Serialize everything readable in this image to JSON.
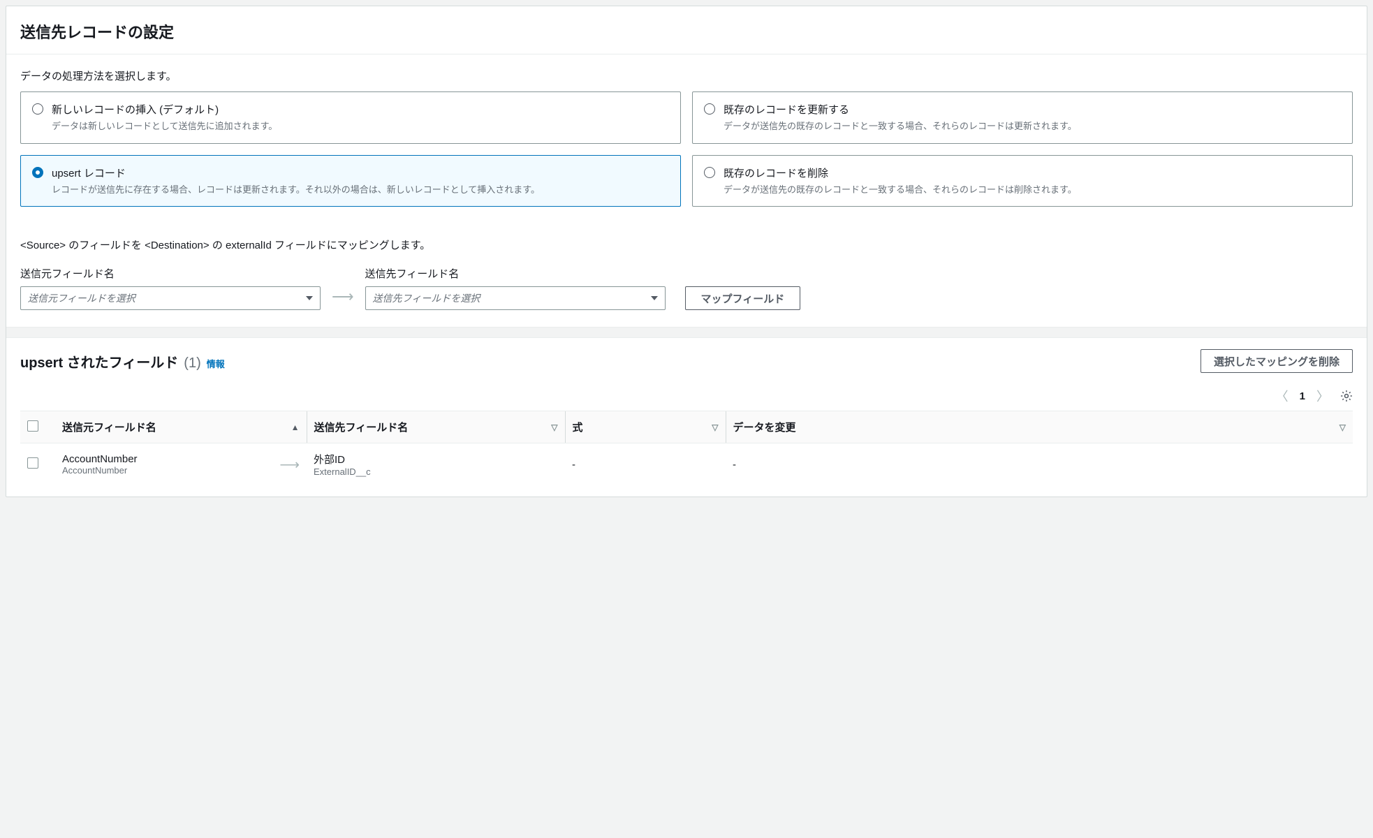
{
  "header": {
    "title": "送信先レコードの設定"
  },
  "processing": {
    "label": "データの処理方法を選択します。",
    "options": [
      {
        "title": "新しいレコードの挿入 (デフォルト)",
        "desc": "データは新しいレコードとして送信先に追加されます。",
        "selected": false
      },
      {
        "title": "既存のレコードを更新する",
        "desc": "データが送信先の既存のレコードと一致する場合、それらのレコードは更新されます。",
        "selected": false
      },
      {
        "title": "upsert レコード",
        "desc": "レコードが送信先に存在する場合、レコードは更新されます。それ以外の場合は、新しいレコードとして挿入されます。",
        "selected": true
      },
      {
        "title": "既存のレコードを削除",
        "desc": "データが送信先の既存のレコードと一致する場合、それらのレコードは削除されます。",
        "selected": false
      }
    ]
  },
  "mapping": {
    "instruction": "<Source> のフィールドを <Destination> の externalId フィールドにマッピングします。",
    "source_label": "送信元フィールド名",
    "dest_label": "送信先フィールド名",
    "source_placeholder": "送信元フィールドを選択",
    "dest_placeholder": "送信先フィールドを選択",
    "map_button": "マップフィールド"
  },
  "upsert_table": {
    "title": "upsert されたフィールド",
    "count": "(1)",
    "info_label": "情報",
    "delete_button": "選択したマッピングを削除",
    "pagination": {
      "current": "1"
    },
    "columns": {
      "source": "送信元フィールド名",
      "dest": "送信先フィールド名",
      "expression": "式",
      "modify": "データを変更"
    },
    "rows": [
      {
        "source_main": "AccountNumber",
        "source_sub": "AccountNumber",
        "dest_main": "外部ID",
        "dest_sub": "ExternalID__c",
        "expression": "-",
        "modify": "-"
      }
    ]
  }
}
